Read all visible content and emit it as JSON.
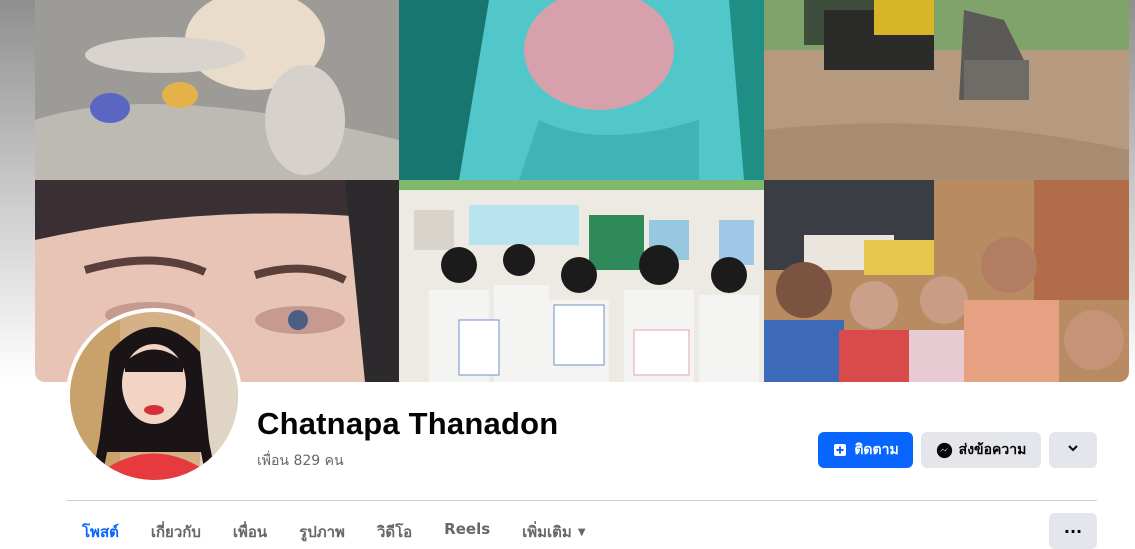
{
  "profile": {
    "name": "Chatnapa Thanadon",
    "friends_text": "เพื่อน 829 คน"
  },
  "actions": {
    "follow_label": "ติดตาม",
    "message_label": "ส่งข้อความ",
    "dropdown_icon": "chevron-down-icon"
  },
  "tabs": [
    {
      "label": "โพสต์",
      "active": true
    },
    {
      "label": "เกี่ยวกับ",
      "active": false
    },
    {
      "label": "เพื่อน",
      "active": false
    },
    {
      "label": "รูปภาพ",
      "active": false
    },
    {
      "label": "วิดีโอ",
      "active": false
    },
    {
      "label": "Reels",
      "active": false
    },
    {
      "label": "เพิ่มเติม",
      "active": false
    }
  ],
  "more_menu_label": "···",
  "colors": {
    "accent": "#0866ff",
    "secondary_button": "#e4e6eb",
    "text_primary": "#050505",
    "text_secondary": "#65676b"
  }
}
